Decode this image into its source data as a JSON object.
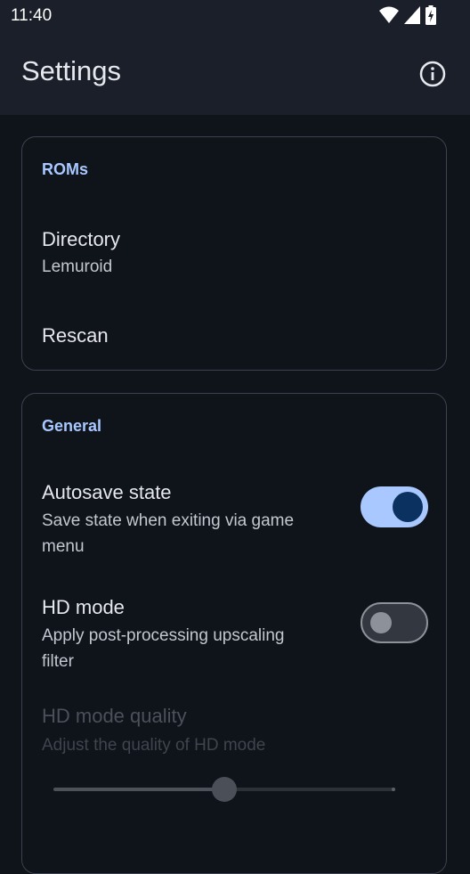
{
  "status_bar": {
    "time": "11:40",
    "icons": [
      "wifi-icon",
      "signal-icon",
      "battery-charging-icon"
    ]
  },
  "app_bar": {
    "title": "Settings",
    "action_icon": "info-icon"
  },
  "roms": {
    "header": "ROMs",
    "directory": {
      "title": "Directory",
      "summary": "Lemuroid"
    },
    "rescan": {
      "title": "Rescan"
    }
  },
  "general": {
    "header": "General",
    "autosave": {
      "title": "Autosave state",
      "summary_line1": "Save state when exiting via game",
      "summary_line2": "menu",
      "checked": true
    },
    "hd_mode": {
      "title": "HD mode",
      "summary_line1": "Apply post-processing upscaling",
      "summary_line2": "filter",
      "checked": false
    },
    "hd_quality": {
      "title": "HD mode quality",
      "summary": "Adjust the quality of HD mode",
      "enabled": false,
      "slider_value_fraction": 0.5
    }
  },
  "colors": {
    "accent": "#a8c8ff",
    "background": "#0f131a",
    "app_bar": "#1a1f29"
  }
}
